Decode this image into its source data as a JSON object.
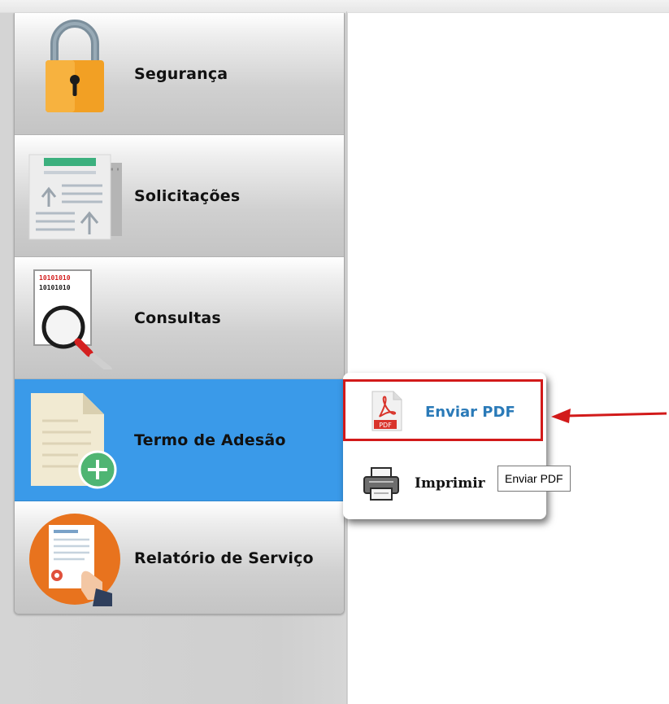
{
  "menu": {
    "items": [
      {
        "label": "Segurança",
        "icon": "padlock-icon",
        "active": false
      },
      {
        "label": "Solicitações",
        "icon": "requests-document-icon",
        "active": false
      },
      {
        "label": "Consultas",
        "icon": "magnifier-binary-icon",
        "active": false
      },
      {
        "label": "Termo de Adesão",
        "icon": "document-add-icon",
        "active": true
      },
      {
        "label": "Relatório de Serviço",
        "icon": "certificate-report-icon",
        "active": false
      }
    ]
  },
  "consultas_icon_text": "10101010",
  "popup": {
    "pdf": {
      "label": "Enviar PDF",
      "icon_text": "PDF",
      "icon": "pdf-file-icon"
    },
    "print": {
      "label": "Imprimir",
      "icon": "printer-icon"
    }
  },
  "tooltip": {
    "text": "Enviar PDF"
  },
  "colors": {
    "active_item": "#3a9ae9",
    "highlight_border": "#d21a1a",
    "pdf_label": "#2a7ab8",
    "arrow": "#d21a1a"
  }
}
